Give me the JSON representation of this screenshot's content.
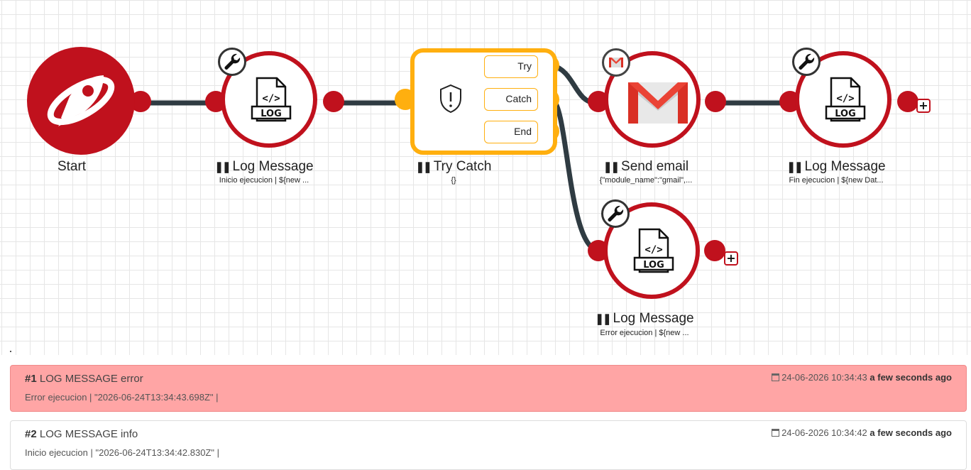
{
  "nodes": {
    "start": {
      "title": "Start"
    },
    "log1": {
      "title": "Log Message",
      "subtitle": "Inicio ejecucion | ${new ...",
      "icon": "log-file-icon"
    },
    "trycatch": {
      "title": "Try Catch",
      "subtitle": "{}",
      "branches": [
        "Try",
        "Catch",
        "End"
      ],
      "icon": "shield-alert-icon"
    },
    "email": {
      "title": "Send email",
      "subtitle": "{\"module_name\":\"gmail\",...",
      "icon": "gmail-icon"
    },
    "log2": {
      "title": "Log Message",
      "subtitle": "Fin ejecucion | ${new Dat...",
      "icon": "log-file-icon"
    },
    "log3": {
      "title": "Log Message",
      "subtitle": "Error ejecucion | ${new ...",
      "icon": "log-file-icon"
    }
  },
  "add_label": "+",
  "logs": [
    {
      "num": "#1",
      "label": "LOG MESSAGE error",
      "message": "Error ejecucion | \"2026-06-24T13:34:43.698Z\" |",
      "date": "24-06-2026 10:34:43",
      "relative": "a few seconds ago"
    },
    {
      "num": "#2",
      "label": "LOG MESSAGE info",
      "message": "Inicio ejecucion | \"2026-06-24T13:34:42.830Z\" |",
      "date": "24-06-2026 10:34:42",
      "relative": "a few seconds ago"
    }
  ],
  "colors": {
    "node": "#c0111d",
    "trycatch": "#ffaf0f",
    "wire": "#2f3b42",
    "error_bg": "#ffa5a5"
  }
}
